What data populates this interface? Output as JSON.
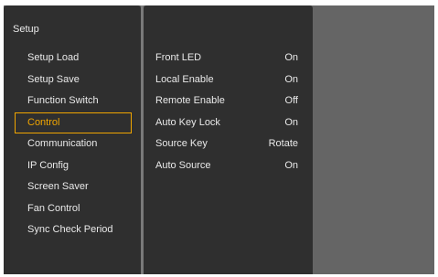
{
  "title": "Setup",
  "menu": [
    {
      "label": "Setup Load"
    },
    {
      "label": "Setup Save"
    },
    {
      "label": "Function Switch"
    },
    {
      "label": "Control",
      "selected": true
    },
    {
      "label": "Communication"
    },
    {
      "label": "IP Config"
    },
    {
      "label": "Screen Saver"
    },
    {
      "label": "Fan Control"
    },
    {
      "label": "Sync Check Period"
    }
  ],
  "settings": [
    {
      "name": "Front LED",
      "value": "On"
    },
    {
      "name": "Local Enable",
      "value": "On"
    },
    {
      "name": "Remote Enable",
      "value": "Off"
    },
    {
      "name": "Auto Key Lock",
      "value": "On"
    },
    {
      "name": "Source Key",
      "value": "Rotate"
    },
    {
      "name": "Auto Source",
      "value": "On"
    }
  ],
  "colors": {
    "panel": "#2f2f2f",
    "background": "#656565",
    "highlight": "#f0a500",
    "text": "#eaeaea"
  }
}
